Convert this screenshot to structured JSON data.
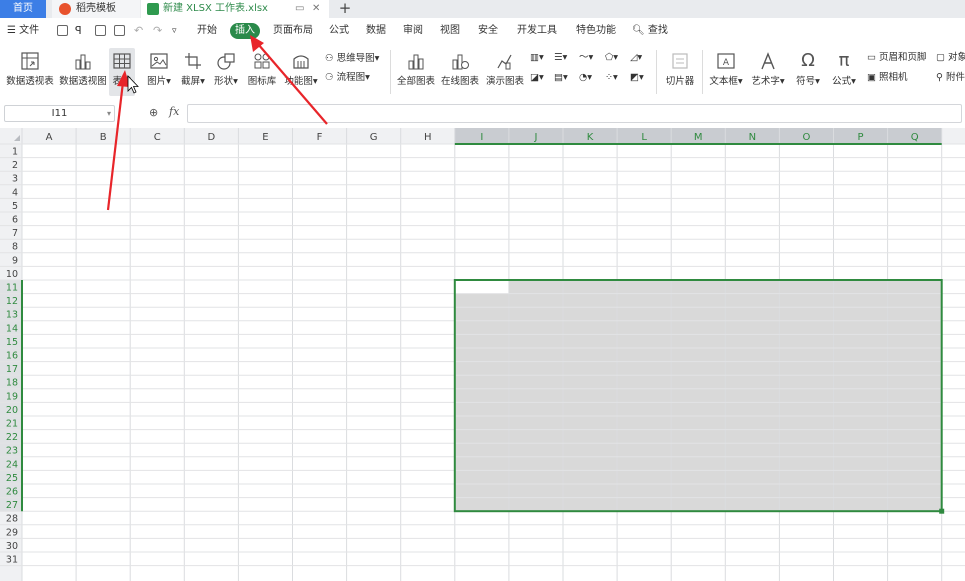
{
  "tabs": {
    "home": "首页",
    "template": "稻壳模板",
    "file": "新建 XLSX 工作表.xlsx"
  },
  "menu": {
    "file": "文件",
    "items": [
      "开始",
      "插入",
      "页面布局",
      "公式",
      "数据",
      "审阅",
      "视图",
      "安全",
      "开发工具",
      "特色功能"
    ],
    "active_index": 1,
    "search": "查找"
  },
  "ribbon": {
    "pivot_table": "数据透视表",
    "pivot_chart": "数据透视图",
    "table": "表格",
    "picture": "图片",
    "screenshot": "截屏",
    "shape": "形状",
    "icon_library": "图标库",
    "function_chart": "功能图",
    "mind_map": "思维导图",
    "flow_chart": "流程图",
    "all_charts": "全部图表",
    "online_charts": "在线图表",
    "demo_charts": "演示图表",
    "slicer": "切片器",
    "text_box": "文本框",
    "art_text": "艺术字",
    "symbol": "符号",
    "formula": "公式",
    "header_footer": "页眉和页脚",
    "camera": "照相机",
    "object": "对象",
    "attachment": "附件"
  },
  "formula_bar": {
    "cell_ref": "I11",
    "fx": "fx",
    "value": ""
  },
  "grid": {
    "columns": [
      "A",
      "B",
      "C",
      "D",
      "E",
      "F",
      "G",
      "H",
      "I",
      "J",
      "K",
      "L",
      "M",
      "N",
      "O",
      "P",
      "Q"
    ],
    "rows": [
      1,
      2,
      3,
      4,
      5,
      6,
      7,
      8,
      9,
      10,
      11,
      12,
      13,
      14,
      15,
      16,
      17,
      18,
      19,
      20,
      21,
      22,
      23,
      24,
      25,
      26,
      27,
      28,
      29,
      30,
      31
    ],
    "selection": "I11:Q27",
    "active_cell": "I11"
  },
  "colors": {
    "accent": "#2a8a4a",
    "tab_active": "#3c7ee6",
    "selection_fill": "#d9d9d9",
    "selection_border": "#2f8a3f",
    "annotation_arrow": "#e8252a"
  },
  "icons": [
    "list-icon",
    "save-icon",
    "print-icon",
    "print-preview-icon",
    "undo-icon",
    "redo-icon",
    "search-icon",
    "mouse-cursor-icon"
  ]
}
